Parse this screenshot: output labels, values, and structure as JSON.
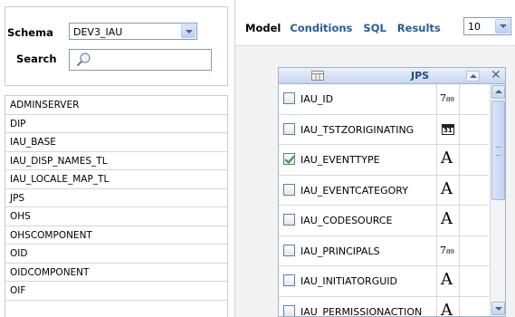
{
  "left": {
    "schema_label": "Schema",
    "schema_value": "DEV3_IAU",
    "search_label": "Search",
    "search_value": "",
    "entities": [
      "ADMINSERVER",
      "DIP",
      "IAU_BASE",
      "IAU_DISP_NAMES_TL",
      "IAU_LOCALE_MAP_TL",
      "JPS",
      "OHS",
      "OHSCOMPONENT",
      "OID",
      "OIDCOMPONENT",
      "OIF"
    ]
  },
  "tabs": {
    "model": "Model",
    "conditions": "Conditions",
    "sql": "SQL",
    "results": "Results",
    "results_count": "10"
  },
  "entity": {
    "title": "JPS",
    "close_glyph": "✕",
    "columns": [
      {
        "name": "IAU_ID",
        "type_icon": "number-type-icon",
        "type_glyph": "7₈₉",
        "checked": false
      },
      {
        "name": "IAU_TSTZORIGINATING",
        "type_icon": "date-type-icon",
        "type_glyph": "31",
        "checked": false
      },
      {
        "name": "IAU_EVENTTYPE",
        "type_icon": "text-type-icon",
        "type_glyph": "A",
        "checked": true
      },
      {
        "name": "IAU_EVENTCATEGORY",
        "type_icon": "text-type-icon",
        "type_glyph": "A",
        "checked": false
      },
      {
        "name": "IAU_CODESOURCE",
        "type_icon": "text-type-icon",
        "type_glyph": "A",
        "checked": false
      },
      {
        "name": "IAU_PRINCIPALS",
        "type_icon": "number-type-icon",
        "type_glyph": "7₈₉",
        "checked": false
      },
      {
        "name": "IAU_INITIATORGUID",
        "type_icon": "text-type-icon",
        "type_glyph": "A",
        "checked": false
      },
      {
        "name": "IAU_PERMISSIONACTION",
        "type_icon": "text-type-icon",
        "type_glyph": "A",
        "checked": false
      }
    ]
  },
  "colors": {
    "tab_link": "#2a5b9c",
    "entity_title": "#1f4a84",
    "check_green": "#21a121"
  }
}
